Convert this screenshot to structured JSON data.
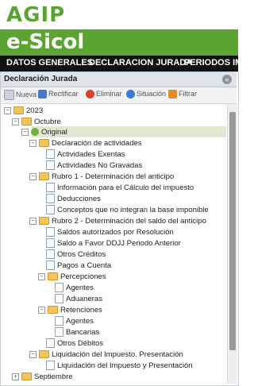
{
  "header": {
    "logo": "AGIP",
    "brand": "e-Sicol"
  },
  "menu": {
    "items": [
      "DATOS GENERALES",
      "DECLARACION JURADA",
      "PERIODOS IMPA"
    ]
  },
  "panel": {
    "title": "Declaración Jurada",
    "collapse_icon": "collapse-icon"
  },
  "toolbar": {
    "nueva": "Nueva",
    "rectificar": "Rectificar",
    "eliminar": "Eliminar",
    "situacion": "Situación",
    "filtrar": "Filtrar"
  },
  "tree": {
    "year": "2023",
    "octubre": "Octubre",
    "original": "Original",
    "declaracion": "Declaración de actividades",
    "exentas": "Actividades Exentas",
    "no_gravadas": "Actividades No Gravadas",
    "rubro1": "Rubro 1 - Determinación del anticipo",
    "info_calc": "Información para el Cálculo del impuesto",
    "deducciones": "Deducciones",
    "conceptos": "Conceptos que no integran la base imponible",
    "rubro2": "Rubro 2 - Determinación del saldo del anticipo",
    "saldos": "Saldos autorizados por Resolución",
    "saldo_favor": "Saldo a Favor DDJJ Periodo Anterior",
    "otros_creditos": "Otros Créditos",
    "pagos": "Pagos a Cuenta",
    "percepciones": "Percepciones",
    "agentes1": "Agentes",
    "aduaneras": "Aduaneras",
    "retenciones": "Retenciones",
    "agentes2": "Agentes",
    "bancarias": "Bancarias",
    "otros_debitos": "Otros Débitos",
    "liquidacion": "Liquidación del Impuesto. Presentación",
    "liquidacion2": "Liquidación del Impuesto y Presentación",
    "septiembre": "Septiembre"
  }
}
